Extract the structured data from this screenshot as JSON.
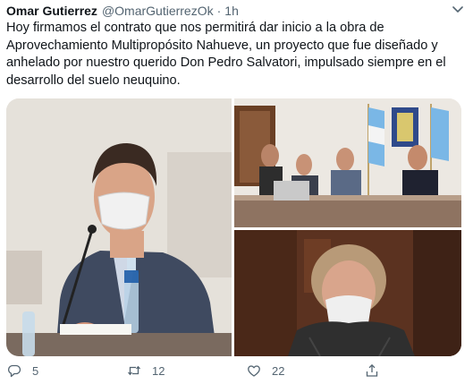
{
  "tweet": {
    "author_name": "Omar Gutierrez",
    "author_handle": "@OmarGutierrezOk",
    "separator": "·",
    "time": "1h",
    "text": "Hoy firmamos el contrato que nos permitirá dar inicio a la obra de Aprovechamiento Multipropósito Nahueve, un proyecto que fue diseñado y anhelado por nuestro querido Don Pedro Salvatori, impulsado siempre en el desarrollo del suelo neuquino."
  },
  "actions": {
    "reply_count": "5",
    "retweet_count": "12",
    "like_count": "22",
    "share_count": ""
  },
  "colors": {
    "text": "#0f1419",
    "muted": "#536471",
    "background": "#ffffff"
  },
  "icons": [
    "caret-down-icon",
    "reply-icon",
    "retweet-icon",
    "like-icon",
    "share-icon"
  ]
}
